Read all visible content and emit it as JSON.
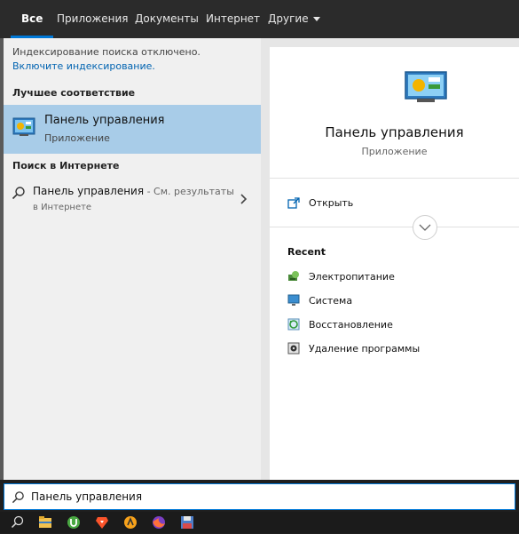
{
  "tabs": [
    {
      "label": "Все"
    },
    {
      "label": "Приложения"
    },
    {
      "label": "Документы"
    },
    {
      "label": "Интернет"
    },
    {
      "label": "Другие"
    }
  ],
  "left": {
    "index_note": "Индексирование поиска отключено.",
    "index_link": "Включите индексирование.",
    "best_match_heading": "Лучшее соответствие",
    "best_match": {
      "title": "Панель управления",
      "subtitle": "Приложение",
      "icon": "control-panel-icon"
    },
    "web_heading": "Поиск в Интернете",
    "web_result": {
      "title": "Панель управления",
      "suffix": " - См. результаты",
      "subtitle": "в Интернете"
    }
  },
  "right": {
    "title": "Панель управления",
    "subtitle": "Приложение",
    "open_label": "Открыть",
    "recent_heading": "Recent",
    "recent": [
      {
        "label": "Электропитание",
        "icon": "power-options-icon"
      },
      {
        "label": "Система",
        "icon": "system-icon"
      },
      {
        "label": "Восстановление",
        "icon": "recovery-icon"
      },
      {
        "label": "Удаление программы",
        "icon": "uninstall-program-icon"
      }
    ]
  },
  "search": {
    "value": "Панель управления"
  },
  "taskbar": {
    "apps": [
      "search-icon",
      "file-explorer-icon",
      "utorrent-icon",
      "brave-icon",
      "avast-icon",
      "firefox-icon",
      "floppy-icon"
    ]
  },
  "colors": {
    "accent": "#0078d7",
    "selected": "#a8cce8",
    "tabbar": "#2b2b2b",
    "taskbar": "#1b1b1b"
  }
}
